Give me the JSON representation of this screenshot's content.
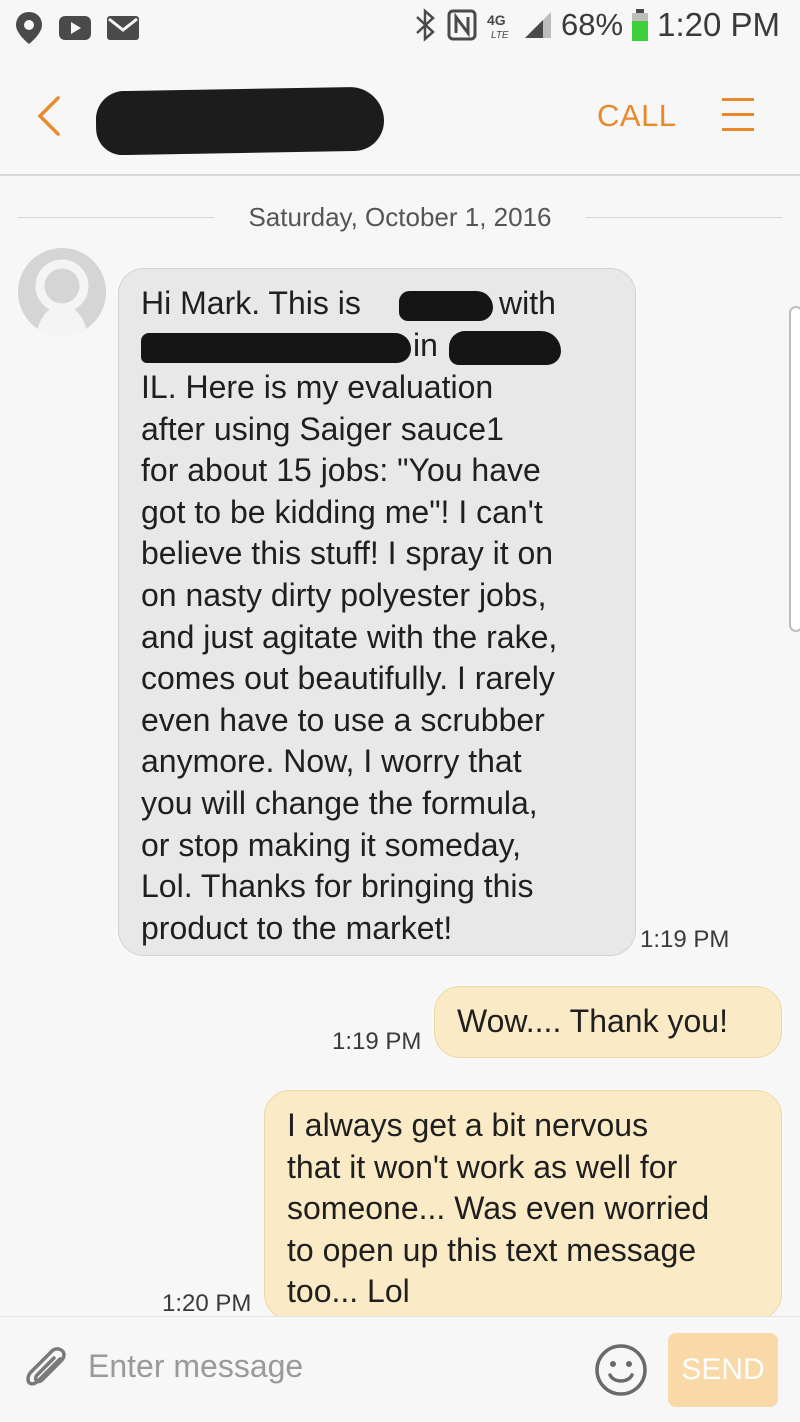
{
  "status_bar": {
    "battery_percent": "68%",
    "time": "1:20 PM",
    "network": "4G LTE",
    "icons": [
      "location-icon",
      "youtube-icon",
      "mail-icon",
      "bluetooth-icon",
      "nfc-icon",
      "signal-icon",
      "battery-icon"
    ]
  },
  "header": {
    "call_label": "CALL"
  },
  "thread": {
    "date": "Saturday, October 1, 2016",
    "incoming": {
      "line1_start": "Hi Mark. This is",
      "line1_end": "with",
      "line2_mid": "in",
      "body": "IL. Here is my evaluation\nafter using Saiger sauce1\nfor about 15 jobs: \"You have\ngot to be kidding me\"! I can't\nbelieve this stuff! I spray it on\non nasty dirty polyester jobs,\nand just agitate with the rake,\ncomes out beautifully. I rarely\neven have to use a scrubber\nanymore. Now, I worry that\nyou will change the formula,\nor stop making it someday,\nLol. Thanks for bringing this\nproduct to the market!",
      "time": "1:19 PM"
    },
    "outgoing": [
      {
        "text": "Wow.... Thank you!",
        "time": "1:19 PM"
      },
      {
        "text": "I always get a bit nervous\nthat it won't work as well for\nsomeone... Was even worried\nto open up this text message\ntoo... Lol",
        "time": "1:20 PM"
      }
    ]
  },
  "composer": {
    "placeholder": "Enter message",
    "send_label": "SEND"
  },
  "colors": {
    "accent": "#e8892b",
    "incoming_bubble": "#e8e8e8",
    "outgoing_bubble": "#fbeac6",
    "send_button": "#f8d9a7"
  }
}
